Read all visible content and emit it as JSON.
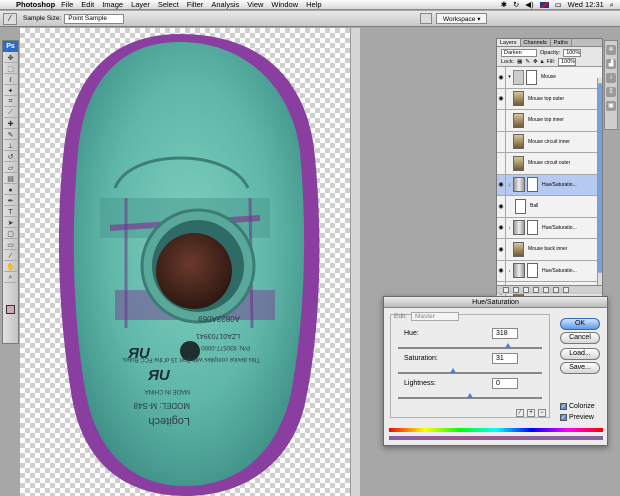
{
  "menubar": {
    "app_name": "Photoshop",
    "items": [
      "File",
      "Edit",
      "Image",
      "Layer",
      "Select",
      "Filter",
      "Analysis",
      "View",
      "Window",
      "Help"
    ],
    "clock": "Wed 12:31"
  },
  "options": {
    "sample_size_label": "Sample Size:",
    "sample_size_value": "Point Sample",
    "workspace_label": "Workspace ▾"
  },
  "toolbox": {
    "badge": "Ps",
    "tools": [
      "move-icon",
      "marquee-icon",
      "lasso-icon",
      "magic-wand-icon",
      "crop-icon",
      "slice-icon",
      "heal-icon",
      "brush-icon",
      "stamp-icon",
      "history-brush-icon",
      "eraser-icon",
      "gradient-icon",
      "dodge-icon",
      "pen-icon",
      "type-icon",
      "path-select-icon",
      "shape-icon",
      "notes-icon",
      "eyedropper-icon",
      "hand-icon",
      "zoom-icon"
    ]
  },
  "layers_panel": {
    "tabs": [
      "Layers",
      "Channels",
      "Paths"
    ],
    "blend_mode": "Darken",
    "opacity_label": "Opacity:",
    "opacity_value": "100%",
    "lock_label": "Lock:",
    "fill_label": "Fill:",
    "fill_value": "100%",
    "layers": [
      {
        "name": "Mouse",
        "kind": "group",
        "visible": true
      },
      {
        "name": "Mouse top outer",
        "kind": "image",
        "visible": true
      },
      {
        "name": "Mouse top inner",
        "kind": "image",
        "visible": false
      },
      {
        "name": "Mouse circuit inner",
        "kind": "image",
        "visible": false
      },
      {
        "name": "Mouse circuit outer",
        "kind": "image",
        "visible": false
      },
      {
        "name": "Hue/Saturatio...",
        "kind": "adjustment",
        "visible": true,
        "selected": true
      },
      {
        "name": "Ball",
        "kind": "image",
        "visible": true
      },
      {
        "name": "Hue/Saturatio...",
        "kind": "adjustment",
        "visible": true
      },
      {
        "name": "Mouse back inner",
        "kind": "image",
        "visible": true
      },
      {
        "name": "Hue/Saturatio...",
        "kind": "adjustment",
        "visible": true
      },
      {
        "name": "Mouse back outer",
        "kind": "image",
        "visible": true
      }
    ]
  },
  "hue_sat_dialog": {
    "title": "Hue/Saturation",
    "edit_label": "Edit:",
    "edit_value": "Master",
    "hue_label": "Hue:",
    "hue_value": "318",
    "saturation_label": "Saturation:",
    "saturation_value": "31",
    "lightness_label": "Lightness:",
    "lightness_value": "0",
    "ok_label": "OK",
    "cancel_label": "Cancel",
    "load_label": "Load...",
    "save_label": "Save...",
    "colorize_label": "Colorize",
    "preview_label": "Preview",
    "colorize_checked": true,
    "preview_checked": true
  },
  "canvas_labels": {
    "model": "MODEL: M-S48",
    "brand": "Logitech",
    "made_in": "MADE IN CHINA",
    "fcc_note": "This device complies with Part 15 of the FCC Rules.",
    "pn": "P/N: 830577-0000",
    "serial": "LZA01703941",
    "barcode_text": "A0823A069"
  },
  "colors": {
    "accent": "#5d9ae6",
    "mouse_body": "#5fb7a8",
    "mouse_rim": "#8a3fa0",
    "ball": "#4a2a20"
  }
}
